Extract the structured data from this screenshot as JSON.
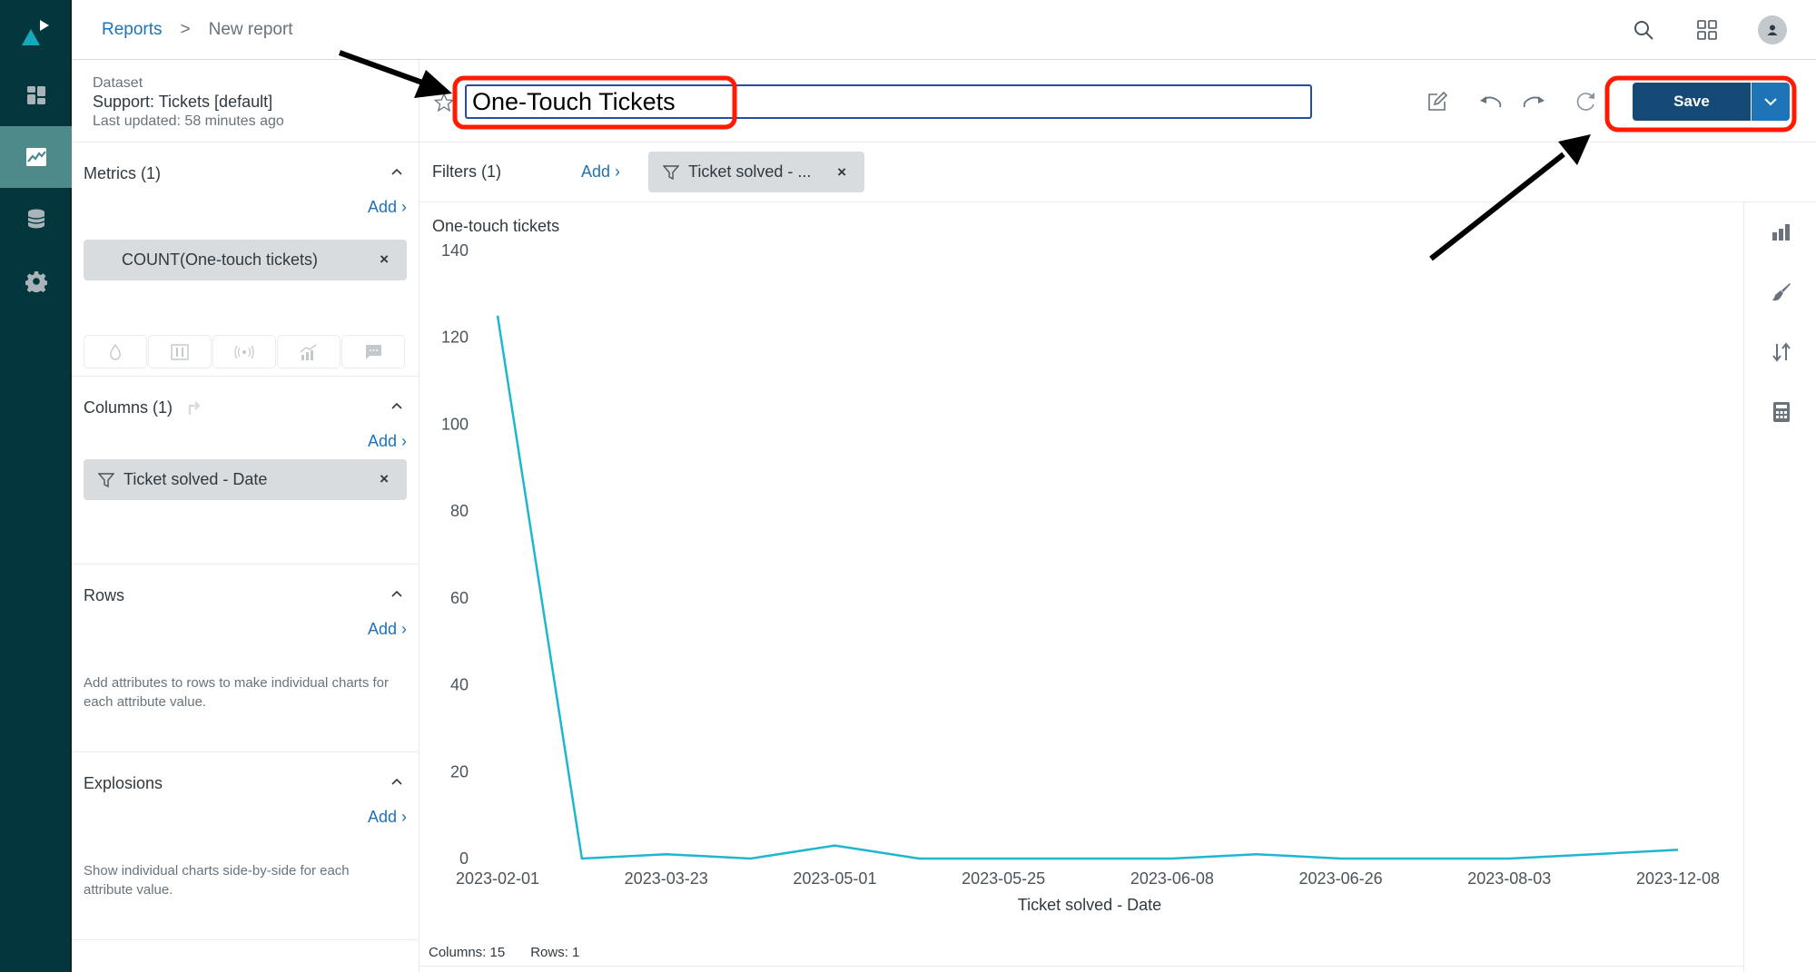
{
  "nav": {
    "items": [
      {
        "name": "dashboards",
        "icon": "dashboard-icon",
        "active": false
      },
      {
        "name": "reports",
        "icon": "line-chart-icon",
        "active": true
      },
      {
        "name": "datasets",
        "icon": "database-icon",
        "active": false
      },
      {
        "name": "settings",
        "icon": "gear-icon",
        "active": false
      }
    ]
  },
  "breadcrumb": {
    "root": "Reports",
    "separator": ">",
    "current": "New report"
  },
  "dataset": {
    "label": "Dataset",
    "name": "Support: Tickets [default]",
    "updated": "Last updated: 58 minutes ago"
  },
  "sections": {
    "metrics": {
      "title": "Metrics (1)",
      "add": "Add ›",
      "items": [
        "COUNT(One-touch tickets)"
      ]
    },
    "columns": {
      "title": "Columns (1)",
      "add": "Add ›",
      "items": [
        "Ticket solved - Date"
      ]
    },
    "rows": {
      "title": "Rows",
      "add": "Add ›",
      "description": "Add attributes to rows to make individual charts for each attribute value."
    },
    "explosions": {
      "title": "Explosions",
      "add": "Add ›",
      "description": "Show individual charts side-by-side for each attribute value."
    }
  },
  "report": {
    "title_value": "One-Touch Tickets",
    "save_label": "Save"
  },
  "filters": {
    "label": "Filters (1)",
    "add": "Add ›",
    "items": [
      "Ticket solved - ..."
    ]
  },
  "footer": {
    "columns": "Columns: 15",
    "rows": "Rows: 1"
  },
  "colors": {
    "nav_bg": "#03363d",
    "nav_active": "#4f8a8b",
    "link": "#1f73b7",
    "save": "#144a75",
    "save_menu": "#1f73b7",
    "series": "#1fb6cf",
    "annotation": "#ff1a00"
  },
  "chart_data": {
    "type": "line",
    "title": "One-touch tickets",
    "xlabel": "Ticket solved - Date",
    "ylabel": "One-touch tickets",
    "ylim": [
      0,
      140
    ],
    "yticks": [
      0,
      20,
      40,
      60,
      80,
      100,
      120,
      140
    ],
    "x_tick_labels": [
      "2023-02-01",
      "2023-03-23",
      "2023-05-01",
      "2023-05-25",
      "2023-06-08",
      "2023-06-26",
      "2023-08-03",
      "2023-12-08"
    ],
    "x_label_every": 2,
    "grid": false,
    "legend": "none",
    "series": [
      {
        "name": "COUNT(One-touch tickets)",
        "values": [
          125,
          0,
          1,
          0,
          3,
          0,
          0,
          0,
          0,
          1,
          0,
          0,
          0,
          1,
          2
        ]
      }
    ]
  }
}
